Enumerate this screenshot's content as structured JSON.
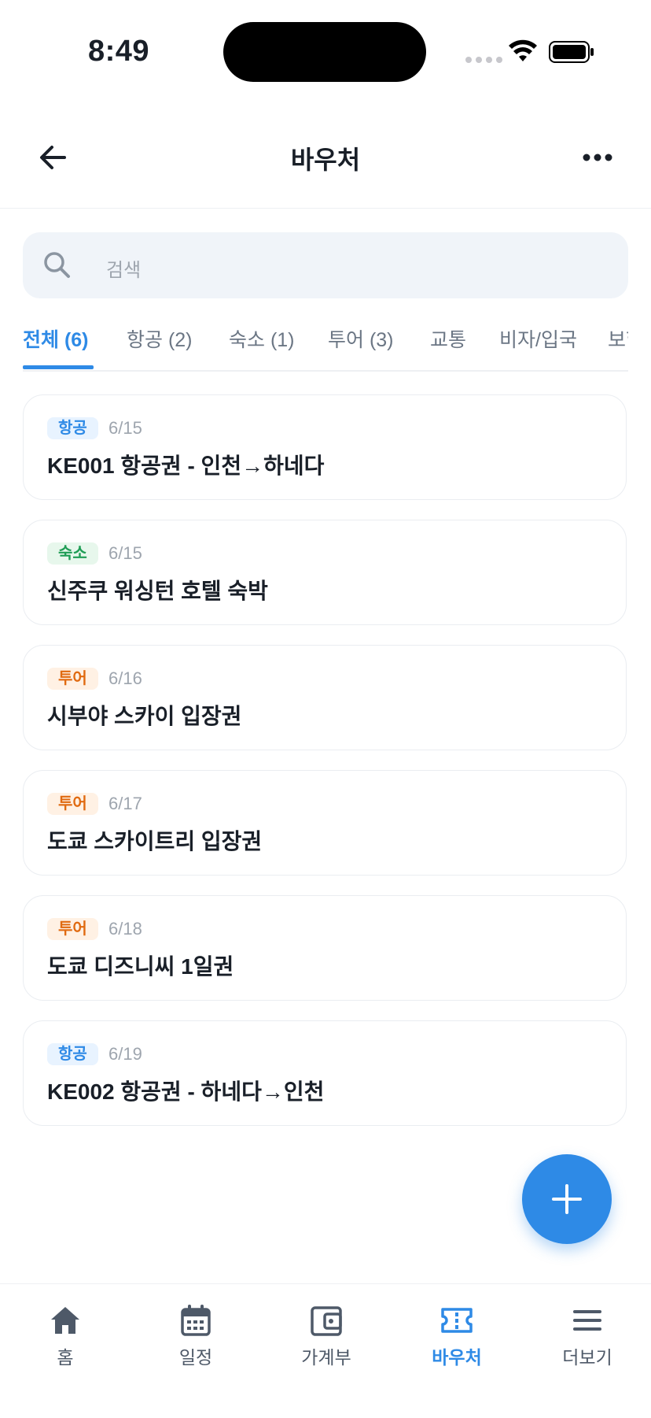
{
  "status_bar": {
    "time": "8:49"
  },
  "header": {
    "title": "바우처"
  },
  "search": {
    "placeholder": "검색"
  },
  "tabs": [
    {
      "label": "전체 (6)",
      "active": true
    },
    {
      "label": "항공 (2)"
    },
    {
      "label": "숙소 (1)"
    },
    {
      "label": "투어 (3)"
    },
    {
      "label": "교통"
    },
    {
      "label": "비자/입국"
    },
    {
      "label": "보험"
    }
  ],
  "vouchers": [
    {
      "category": "항공",
      "date": "6/15",
      "title": "KE001 항공권 - 인천→하네다"
    },
    {
      "category": "숙소",
      "date": "6/15",
      "title": "신주쿠 워싱턴 호텔 숙박"
    },
    {
      "category": "투어",
      "date": "6/16",
      "title": "시부야 스카이 입장권"
    },
    {
      "category": "투어",
      "date": "6/17",
      "title": "도쿄 스카이트리 입장권"
    },
    {
      "category": "투어",
      "date": "6/18",
      "title": "도쿄 디즈니씨 1일권"
    },
    {
      "category": "항공",
      "date": "6/19",
      "title": "KE002 항공권 - 하네다→인천"
    }
  ],
  "bottom_nav": [
    {
      "label": "홈",
      "icon": "home-icon"
    },
    {
      "label": "일정",
      "icon": "calendar-icon"
    },
    {
      "label": "가계부",
      "icon": "wallet-icon"
    },
    {
      "label": "바우처",
      "icon": "ticket-icon",
      "active": true
    },
    {
      "label": "더보기",
      "icon": "menu-icon"
    }
  ],
  "colors": {
    "accent": "#2e8ae6",
    "flight_badge": "#2e8ae6",
    "lodging_badge": "#1f9d55",
    "tour_badge": "#e06a10"
  }
}
